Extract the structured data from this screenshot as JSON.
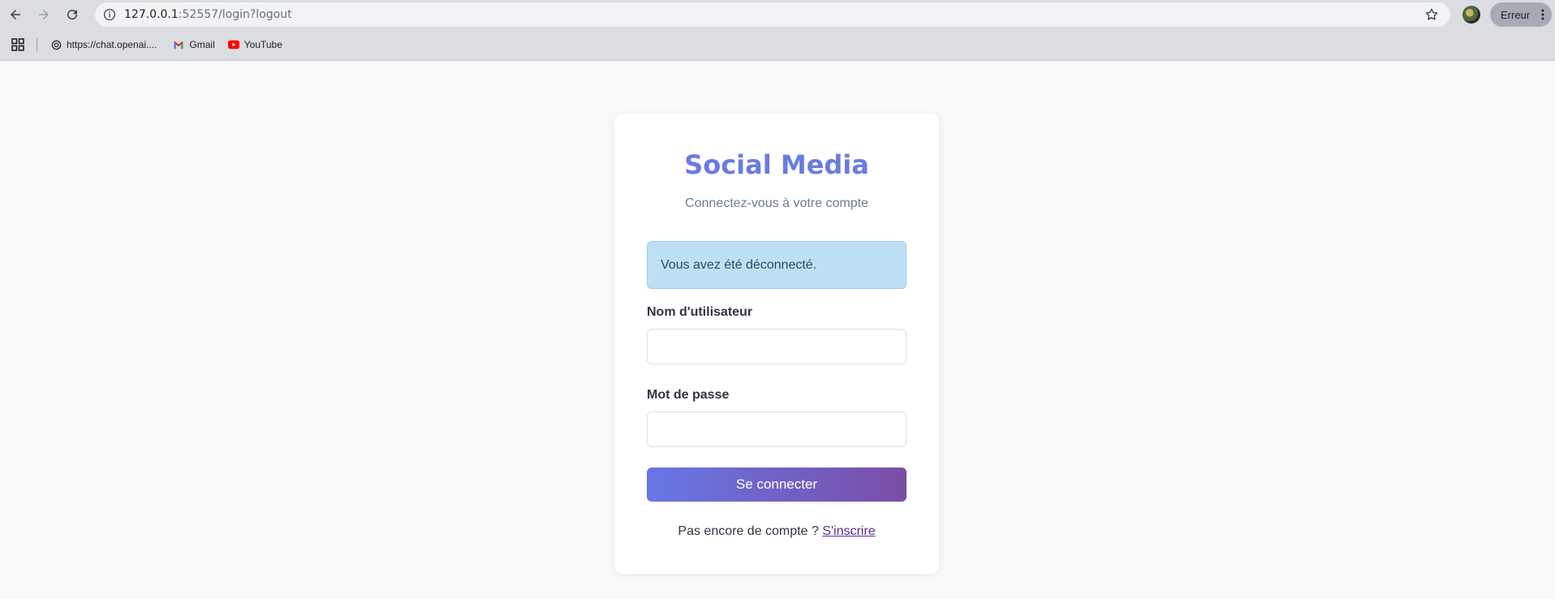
{
  "browser": {
    "url_host": "127.0.0.1",
    "url_rest": ":52557/login?logout",
    "profile_label": "Erreur",
    "bookmarks": [
      {
        "label": "https://chat.openai...."
      },
      {
        "label": "Gmail"
      },
      {
        "label": "YouTube"
      }
    ]
  },
  "login": {
    "title": "Social Media",
    "subtitle": "Connectez-vous à votre compte",
    "alert": "Vous avez été déconnecté.",
    "username_label": "Nom d'utilisateur",
    "username_value": "",
    "password_label": "Mot de passe",
    "password_value": "",
    "submit_label": "Se connecter",
    "footer_text": "Pas encore de compte ?",
    "signup_link": "S'inscrire"
  },
  "colors": {
    "accent": "#6a7be2",
    "button_start": "#6777e6",
    "button_end": "#7a4da6",
    "alert_bg": "#bee0f5"
  }
}
